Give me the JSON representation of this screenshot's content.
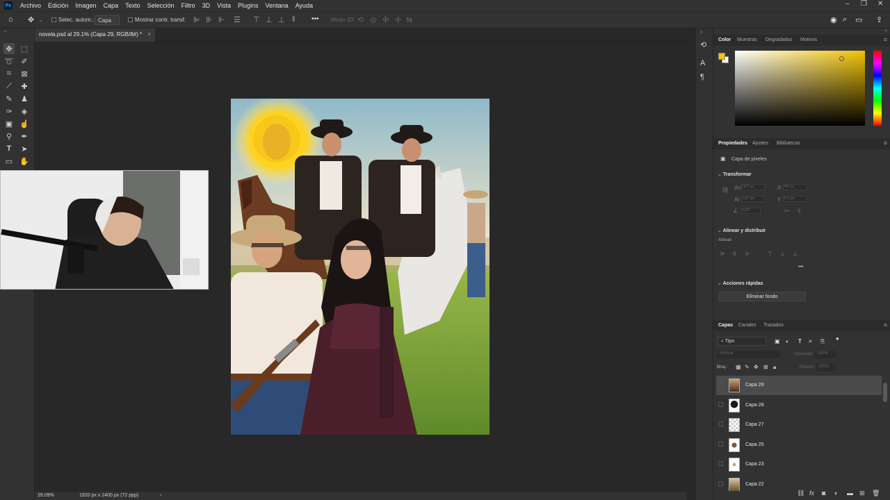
{
  "menubar": {
    "logo": "Ps",
    "items": [
      "Archivo",
      "Edición",
      "Imagen",
      "Capa",
      "Texto",
      "Selección",
      "Filtro",
      "3D",
      "Vista",
      "Plugins",
      "Ventana",
      "Ayuda"
    ]
  },
  "options_bar": {
    "auto_select_label": "Selec. autom.:",
    "auto_select_target": "Capa",
    "show_transform_label": "Mostrar contr. transf.",
    "more_label": "•••",
    "mode_3d_label": "Modo 3D:"
  },
  "document": {
    "tab_title": "novela.psd al 29.1% (Capa 29, RGB/8#) *",
    "close": "×"
  },
  "status_bar": {
    "zoom": "29.09%",
    "doc_info": "1920 px x 2400 px (72 ppp)",
    "arrow": "›"
  },
  "color_panel": {
    "tabs": [
      "Color",
      "Muestras",
      "Degradados",
      "Motivos"
    ],
    "foreground_color": "#f2c200",
    "background_color": "#ffffff"
  },
  "properties_panel": {
    "tabs": [
      "Propiedades",
      "Ajustes",
      "Bibliotecas"
    ],
    "layer_type": "Capa de píxeles",
    "transform_header": "Transformar",
    "transform_fields": {
      "w_label": "An",
      "w_value": "1822 px",
      "h_label": "Al",
      "h_value": "2137 px",
      "x_label": "X",
      "x_value": "465 px",
      "y_label": "Y",
      "y_value": "412 px",
      "angle_value": "0.00°"
    },
    "align_header": "Alinear y distribuir",
    "align_label": "Alinear:",
    "more_label": "•••",
    "quick_actions_header": "Acciones rápidas",
    "remove_bg_button": "Eliminar fondo"
  },
  "layers_panel": {
    "tabs": [
      "Capas",
      "Canales",
      "Trazados"
    ],
    "filter_kind": "Tipo",
    "blend_mode": "Normal",
    "opacity_label": "Opacidad:",
    "opacity_value": "100%",
    "lock_label": "Bloq.:",
    "fill_label": "Relleno:",
    "fill_value": "100%",
    "layers": [
      {
        "name": "Capa 29",
        "selected": true,
        "thumb": "couple"
      },
      {
        "name": "Capa 28",
        "selected": false,
        "thumb": "dark-figure"
      },
      {
        "name": "Capa 27",
        "selected": false,
        "thumb": "empty"
      },
      {
        "name": "Capa 25",
        "selected": false,
        "thumb": "figure"
      },
      {
        "name": "Capa 23",
        "selected": false,
        "thumb": "small"
      },
      {
        "name": "Capa 22",
        "selected": false,
        "thumb": "scene"
      }
    ],
    "footer_icons": [
      "link-icon",
      "fx-icon",
      "mask-icon",
      "adjustment-icon",
      "group-icon",
      "new-layer-icon",
      "trash-icon"
    ]
  },
  "colors": {
    "accent_blue": "#31a8ff",
    "panel_bg": "#323232",
    "app_bg": "#282828",
    "selected_layer": "#4b4b4b"
  }
}
